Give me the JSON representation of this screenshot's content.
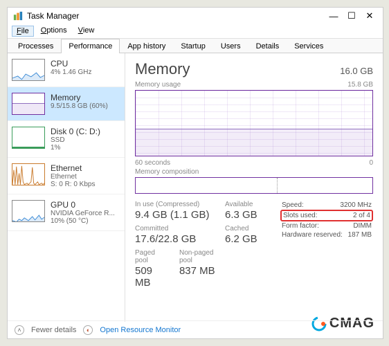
{
  "window": {
    "title": "Task Manager"
  },
  "menu": {
    "file": "File",
    "options": "Options",
    "view": "View"
  },
  "tabs": {
    "processes": "Processes",
    "performance": "Performance",
    "apphistory": "App history",
    "startup": "Startup",
    "users": "Users",
    "details": "Details",
    "services": "Services"
  },
  "sidebar": {
    "cpu": {
      "title": "CPU",
      "sub": "4%  1.46 GHz"
    },
    "memory": {
      "title": "Memory",
      "sub": "9.5/15.8 GB (60%)"
    },
    "disk": {
      "title": "Disk 0 (C: D:)",
      "sub1": "SSD",
      "sub2": "1%"
    },
    "ethernet": {
      "title": "Ethernet",
      "sub1": "Ethernet",
      "sub2": "S: 0  R: 0 Kbps"
    },
    "gpu": {
      "title": "GPU 0",
      "sub1": "NVIDIA GeForce R...",
      "sub2": "10%  (50 °C)"
    }
  },
  "main": {
    "heading": "Memory",
    "total": "16.0 GB",
    "usage_label": "Memory usage",
    "usage_max": "15.8 GB",
    "timespan_left": "60 seconds",
    "timespan_right": "0",
    "composition_label": "Memory composition",
    "stats": {
      "inuse_label": "In use (Compressed)",
      "inuse": "9.4 GB (1.1 GB)",
      "available_label": "Available",
      "available": "6.3 GB",
      "committed_label": "Committed",
      "committed": "17.6/22.8 GB",
      "cached_label": "Cached",
      "cached": "6.2 GB",
      "paged_label": "Paged pool",
      "paged": "509 MB",
      "nonpaged_label": "Non-paged pool",
      "nonpaged": "837 MB"
    },
    "details": {
      "speed_l": "Speed:",
      "speed_v": "3200 MHz",
      "slots_l": "Slots used:",
      "slots_v": "2 of 4",
      "form_l": "Form factor:",
      "form_v": "DIMM",
      "reserved_l": "Hardware reserved:",
      "reserved_v": "187 MB"
    }
  },
  "footer": {
    "fewer": "Fewer details",
    "resmon": "Open Resource Monitor"
  },
  "watermark": "CMAG",
  "chart_data": {
    "type": "area",
    "title": "Memory usage",
    "ylabel": "GB",
    "ylim": [
      0,
      15.8
    ],
    "x": [
      "60s",
      "0"
    ],
    "values_approx": 9.5,
    "percent": 60
  }
}
